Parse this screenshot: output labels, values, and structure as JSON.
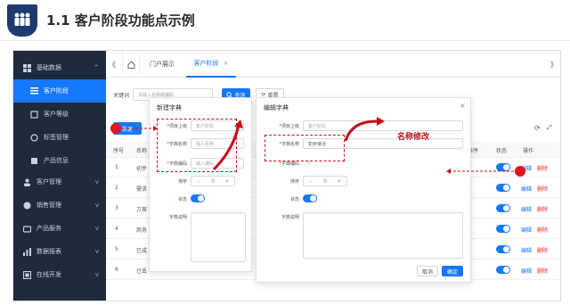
{
  "slide": {
    "title": "1.1 客户阶段功能点示例"
  },
  "sidebar": {
    "items": [
      {
        "label": "基础数据",
        "icon": "grid-icon",
        "chevron": "^"
      },
      {
        "label": "客户阶段",
        "icon": "list-icon"
      },
      {
        "label": "客户等级",
        "icon": "level-icon"
      },
      {
        "label": "标签管理",
        "icon": "tag-icon"
      },
      {
        "label": "产品信息",
        "icon": "product-icon"
      },
      {
        "label": "客户管理",
        "icon": "user-icon",
        "chevron": "v"
      },
      {
        "label": "销售管理",
        "icon": "sales-icon",
        "chevron": "v"
      },
      {
        "label": "产品服务",
        "icon": "service-icon",
        "chevron": "v"
      },
      {
        "label": "数据报表",
        "icon": "report-icon",
        "chevron": "v"
      },
      {
        "label": "在线开发",
        "icon": "dev-icon",
        "chevron": "v"
      }
    ]
  },
  "tabs": {
    "prev": "《",
    "next": "》",
    "home_icon": "home-icon",
    "items": [
      {
        "label": "门户展示"
      },
      {
        "label": "客户阶段",
        "close": "×"
      }
    ]
  },
  "search": {
    "keyword_label": "关键词",
    "placeholder": "请输入名称或编码",
    "search_btn": "查询",
    "reset_btn": "重置"
  },
  "table": {
    "new_btn": "新建",
    "refresh_icon": "refresh-icon",
    "fullscreen_icon": "fullscreen-icon",
    "columns": {
      "seq": "序号",
      "name": "名称",
      "order": "排序",
      "status": "状态",
      "ops": "操作"
    },
    "rows": [
      {
        "seq": "1",
        "name": "初步"
      },
      {
        "seq": "2",
        "name": "需求"
      },
      {
        "seq": "3",
        "name": "方案"
      },
      {
        "seq": "4",
        "name": "商务"
      },
      {
        "seq": "5",
        "name": "已成"
      },
      {
        "seq": "6",
        "name": "已丢"
      }
    ],
    "edit": "编辑",
    "del": "删除"
  },
  "new_dialog": {
    "title": "新建字典",
    "parent_label": "项目上级",
    "parent_placeholder": "客户阶段",
    "name_label": "字典名称",
    "name_placeholder": "输入名称",
    "code_label": "字典编码",
    "code_placeholder": "输入编码",
    "order_label": "排序",
    "order_value": "0",
    "status_label": "状态",
    "desc_label": "字典说明"
  },
  "edit_dialog": {
    "title": "编辑字典",
    "close": "×",
    "parent_label": "项目上级",
    "parent_value": "客户阶段",
    "name_label": "字典名称",
    "name_value": "初步接洽",
    "code_label": "字典编码",
    "code_value": "0",
    "order_label": "排序",
    "order_value": "0",
    "status_label": "状态",
    "desc_label": "字典说明",
    "cancel_btn": "取消",
    "ok_btn": "确定"
  },
  "annotation": {
    "text": "名称修改",
    "color": "#c0121b"
  },
  "colors": {
    "primary": "#1677ff",
    "sidebar": "#1f2a3c",
    "danger": "#f5222d",
    "annotation": "#c0121b"
  }
}
